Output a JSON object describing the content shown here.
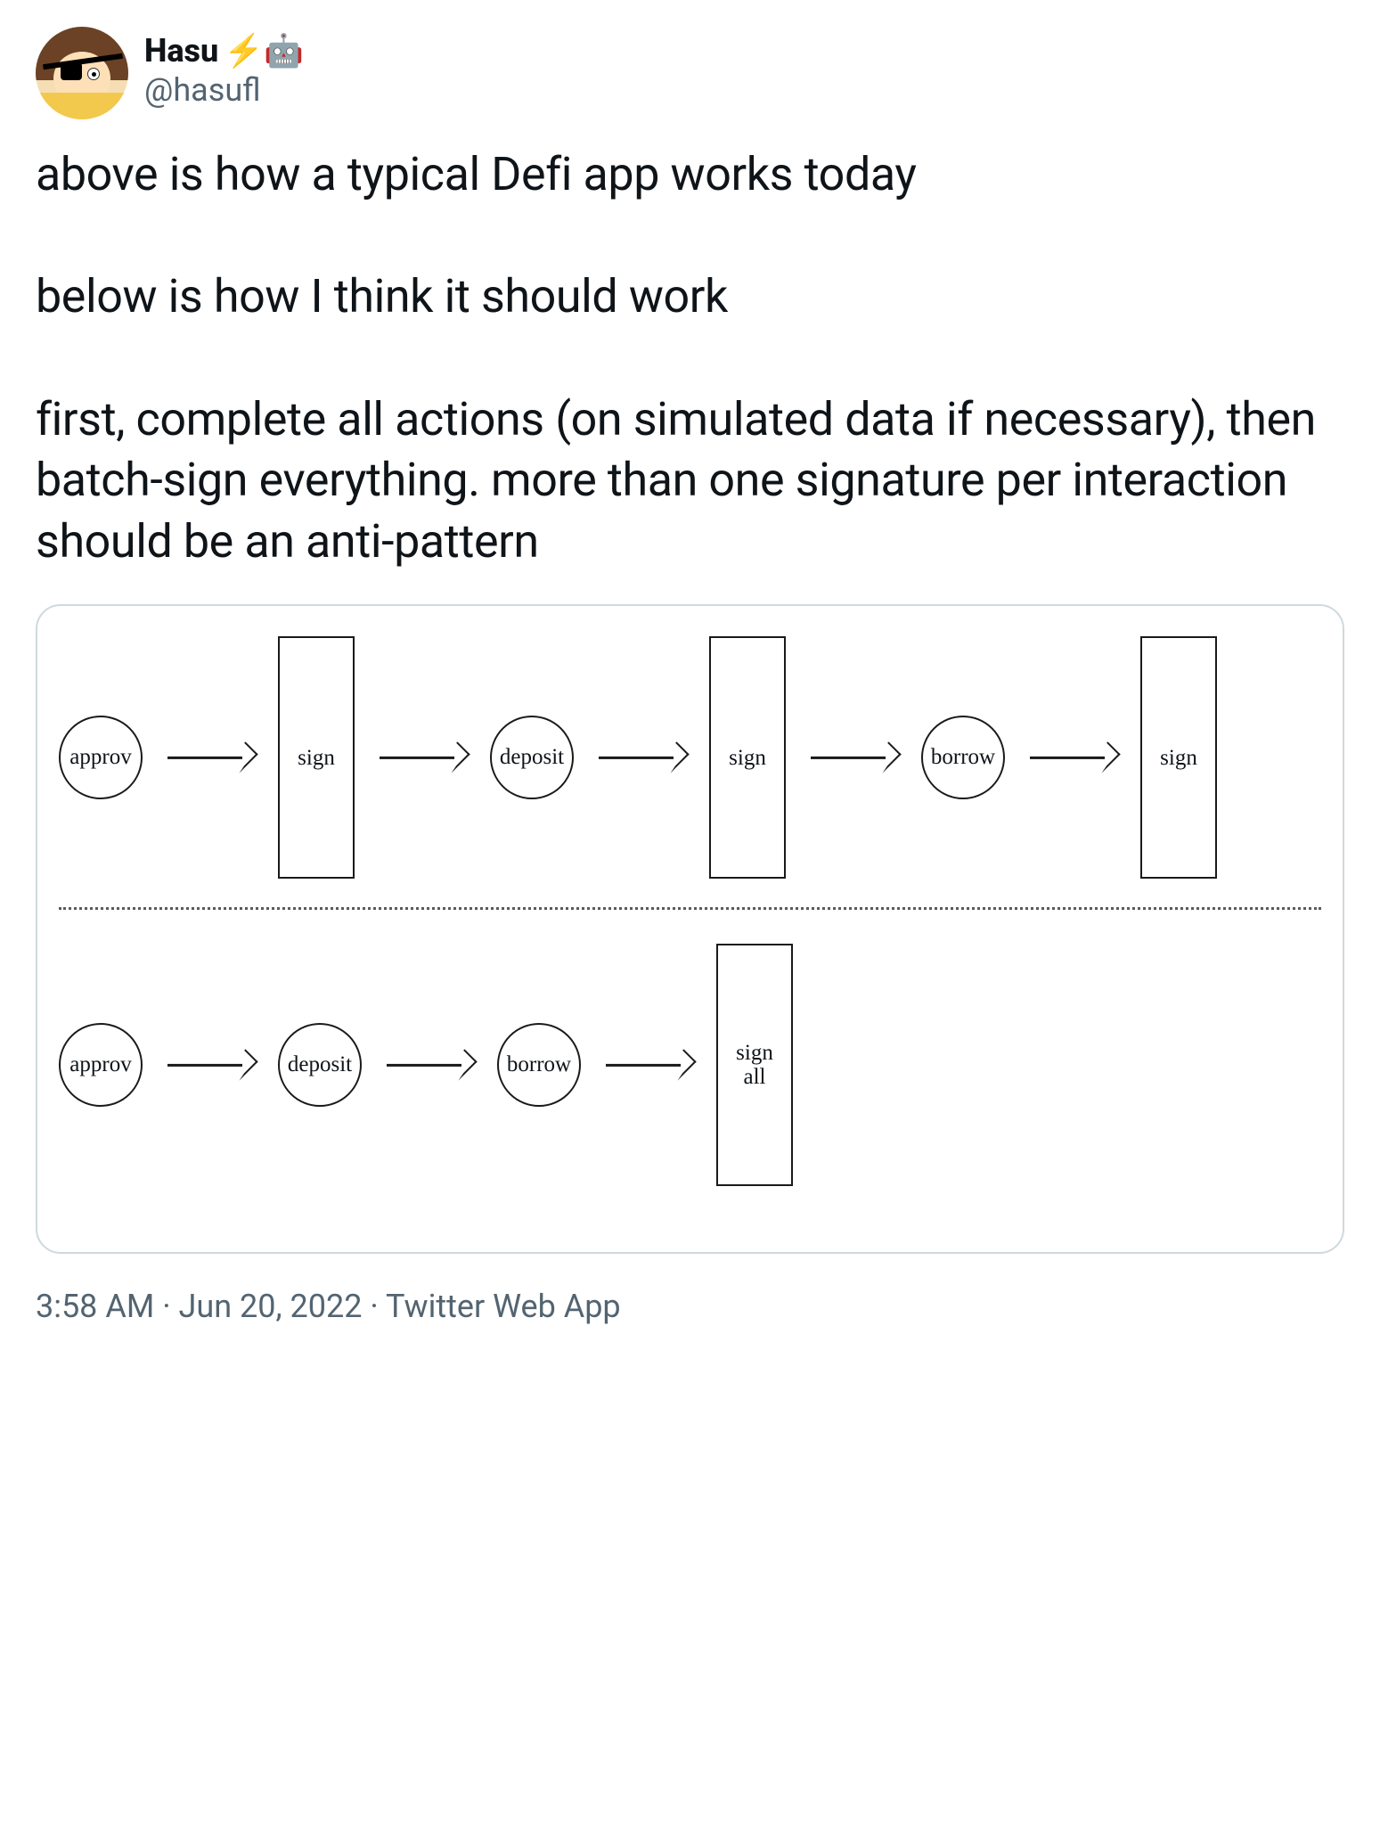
{
  "author": {
    "display_name": "Hasu",
    "emojis": "⚡️🤖",
    "handle": "@hasufl"
  },
  "tweet_text": "above is how a typical Defi app works today\n\nbelow is how I think it should work\n\nfirst, complete all actions (on simulated data if necessary), then batch-sign everything. more than one signature per interaction should be an anti-pattern",
  "diagram": {
    "top_flow": [
      {
        "shape": "circle",
        "label": "approv"
      },
      {
        "shape": "arrow"
      },
      {
        "shape": "tallbox",
        "label": "sign"
      },
      {
        "shape": "arrow"
      },
      {
        "shape": "circle",
        "label": "deposit"
      },
      {
        "shape": "arrow"
      },
      {
        "shape": "tallbox",
        "label": "sign"
      },
      {
        "shape": "arrow"
      },
      {
        "shape": "circle",
        "label": "borrow"
      },
      {
        "shape": "arrow"
      },
      {
        "shape": "tallbox",
        "label": "sign"
      }
    ],
    "bottom_flow": [
      {
        "shape": "circle",
        "label": "approv"
      },
      {
        "shape": "arrow"
      },
      {
        "shape": "circle",
        "label": "deposit"
      },
      {
        "shape": "arrow"
      },
      {
        "shape": "circle",
        "label": "borrow"
      },
      {
        "shape": "arrow"
      },
      {
        "shape": "tallbox",
        "label": "sign\nall"
      }
    ]
  },
  "footer": {
    "time": "3:58 AM",
    "sep1": " · ",
    "date": "Jun 20, 2022",
    "sep2": " · ",
    "source": "Twitter Web App"
  }
}
